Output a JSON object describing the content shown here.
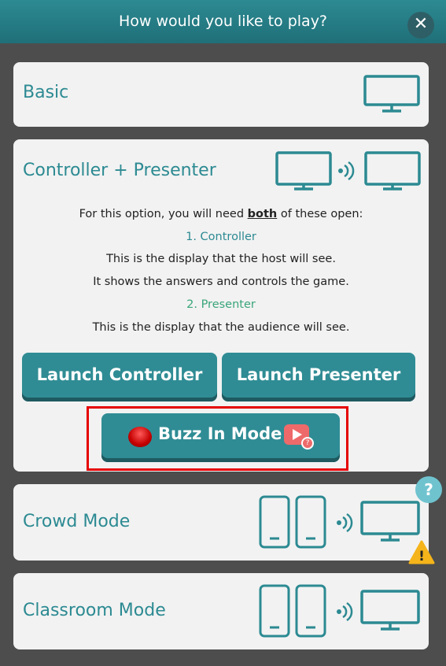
{
  "header": {
    "title": "How would you like to play?",
    "close_glyph": "✕"
  },
  "basic": {
    "title": "Basic",
    "icon": "monitor-icon"
  },
  "controller_presenter": {
    "title": "Controller + Presenter",
    "intro_prefix": "For this option, you will need ",
    "intro_bold": "both",
    "intro_suffix": " of these open:",
    "controller_heading": "1. Controller",
    "controller_desc1": "This is the display that the host will see.",
    "controller_desc2": "It shows the answers and controls the game.",
    "presenter_heading": "2. Presenter",
    "presenter_desc": "This is the display that the audience will see.",
    "launch_controller": "Launch Controller",
    "launch_presenter": "Launch Presenter",
    "buzz_label": "Buzz In Mode",
    "buzz_help_glyph": "?"
  },
  "crowd": {
    "title": "Crowd Mode",
    "help_glyph": "?",
    "warning_glyph": "!"
  },
  "classroom": {
    "title": "Classroom Mode"
  },
  "colors": {
    "accent": "#2c8a92",
    "presenter_green": "#3aa57a",
    "highlight": "#e60000"
  }
}
